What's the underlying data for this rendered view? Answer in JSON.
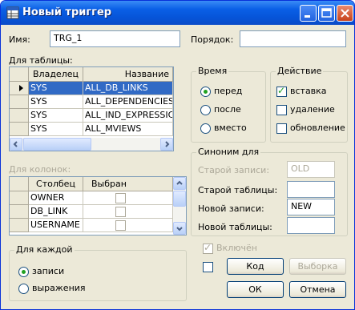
{
  "window": {
    "title": "Новый триггер"
  },
  "name": {
    "label": "Имя:",
    "value": "TRG_1"
  },
  "order": {
    "label": "Порядок:",
    "value": ""
  },
  "table_grid": {
    "label": "Для таблицы:",
    "columns": [
      "Владелец",
      "Название"
    ],
    "rows": [
      {
        "owner": "SYS",
        "name": "ALL_DB_LINKS"
      },
      {
        "owner": "SYS",
        "name": "ALL_DEPENDENCIES"
      },
      {
        "owner": "SYS",
        "name": "ALL_IND_EXPRESSIC"
      },
      {
        "owner": "SYS",
        "name": "ALL_MVIEWS"
      }
    ]
  },
  "columns_grid": {
    "label": "Для колонок:",
    "columns": [
      "Столбец",
      "Выбран"
    ],
    "rows": [
      {
        "column": "OWNER"
      },
      {
        "column": "DB_LINK"
      },
      {
        "column": "USERNAME"
      }
    ]
  },
  "time": {
    "legend": "Время",
    "options": [
      "перед",
      "после",
      "вместо"
    ],
    "selected": "перед"
  },
  "action": {
    "legend": "Действие",
    "options": [
      {
        "label": "вставка",
        "checked": true
      },
      {
        "label": "удаление",
        "checked": false
      },
      {
        "label": "обновление",
        "checked": false
      }
    ]
  },
  "synonym": {
    "legend": "Синоним для",
    "old_record": {
      "label": "Старой записи:",
      "value": "OLD"
    },
    "old_table": {
      "label": "Старой таблицы:",
      "value": ""
    },
    "new_record": {
      "label": "Новой записи:",
      "value": "NEW"
    },
    "new_table": {
      "label": "Новой таблицы:",
      "value": ""
    }
  },
  "for_each": {
    "legend": "Для каждой",
    "options": [
      "записи",
      "выражения"
    ],
    "selected": "записи"
  },
  "enabled": {
    "label": "Включён",
    "checked": true
  },
  "buttons": {
    "code": "Код",
    "select": "Выборка",
    "ok": "ОК",
    "cancel": "Отмена"
  },
  "colors": {
    "title_bar": "#0a5fe6",
    "selection": "#316ac5",
    "window_bg": "#ece9d8"
  }
}
